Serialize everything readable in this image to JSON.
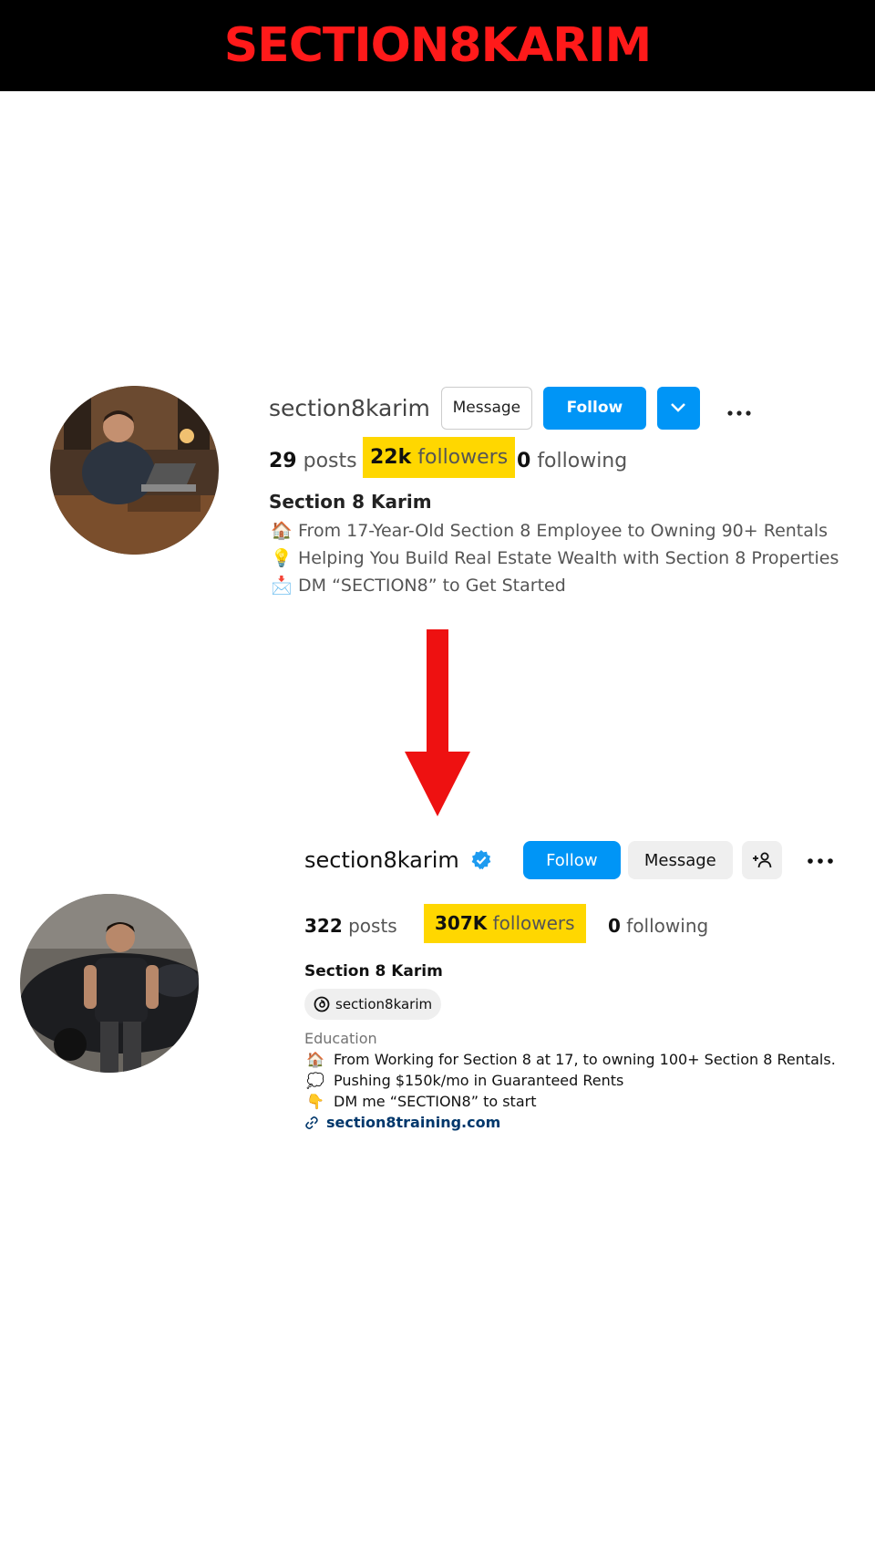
{
  "banner": {
    "title": "SECTION8KARIM"
  },
  "old_profile": {
    "username": "section8karim",
    "message_label": "Message",
    "follow_label": "Follow",
    "stats": {
      "posts_count": "29",
      "posts_label": "posts",
      "followers_count": "22k",
      "followers_label": "followers",
      "following_count": "0",
      "following_label": "following"
    },
    "display_name": "Section 8 Karim",
    "bio": [
      {
        "icon": "house-emoji",
        "text": "From 17-Year-Old Section 8 Employee to Owning 90+ Rentals"
      },
      {
        "icon": "lightbulb-emoji",
        "text": "Helping You Build Real Estate Wealth with Section 8 Properties"
      },
      {
        "icon": "envelope-emoji",
        "text": "DM “SECTION8” to Get Started"
      }
    ]
  },
  "new_profile": {
    "username": "section8karim",
    "follow_label": "Follow",
    "message_label": "Message",
    "stats": {
      "posts_count": "322",
      "posts_label": "posts",
      "followers_count": "307K",
      "followers_label": "followers",
      "following_count": "0",
      "following_label": "following"
    },
    "display_name": "Section 8 Karim",
    "threads_handle": "section8karim",
    "category": "Education",
    "bio": [
      {
        "icon": "house-emoji",
        "text": "From Working for Section 8 at 17, to owning 100+ Section 8 Rentals."
      },
      {
        "icon": "thought-bubble-emoji",
        "text": "Pushing $150k/mo in Guaranteed Rents"
      },
      {
        "icon": "pointing-down-emoji",
        "text": "DM me “SECTION8” to start"
      }
    ],
    "link": "section8training.com"
  },
  "colors": {
    "banner_text": "#ff1a1a",
    "highlight": "#ffd700",
    "follow_blue": "#0095f6",
    "arrow": "#ee1111"
  }
}
